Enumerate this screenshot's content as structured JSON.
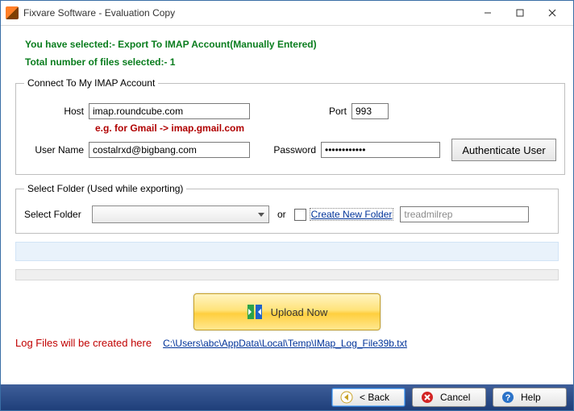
{
  "window": {
    "title": "Fixvare Software - Evaluation Copy"
  },
  "banner": {
    "line1": "You have selected:- Export To IMAP Account(Manually Entered)",
    "line2": "Total number of files selected:- 1"
  },
  "imap_group": {
    "legend": "Connect To My IMAP Account",
    "host_label": "Host",
    "host_value": "imap.roundcube.com",
    "port_label": "Port",
    "port_value": "993",
    "hint": "e.g. for Gmail -> imap.gmail.com",
    "user_label": "User Name",
    "user_value": "costalrxd@bigbang.com",
    "password_label": "Password",
    "password_value": "************",
    "auth_button": "Authenticate User"
  },
  "folder_group": {
    "legend": "Select Folder (Used while exporting)",
    "select_label": "Select Folder",
    "combo_value": "",
    "or_label": "or",
    "create_link": "Create New Folder",
    "new_folder_value": "treadmilrep"
  },
  "upload": {
    "button": "Upload Now"
  },
  "log": {
    "label": "Log Files will be created here",
    "path": "C:\\Users\\abc\\AppData\\Local\\Temp\\IMap_Log_File39b.txt"
  },
  "footer": {
    "back": "< Back",
    "cancel": "Cancel",
    "help": "Help"
  }
}
